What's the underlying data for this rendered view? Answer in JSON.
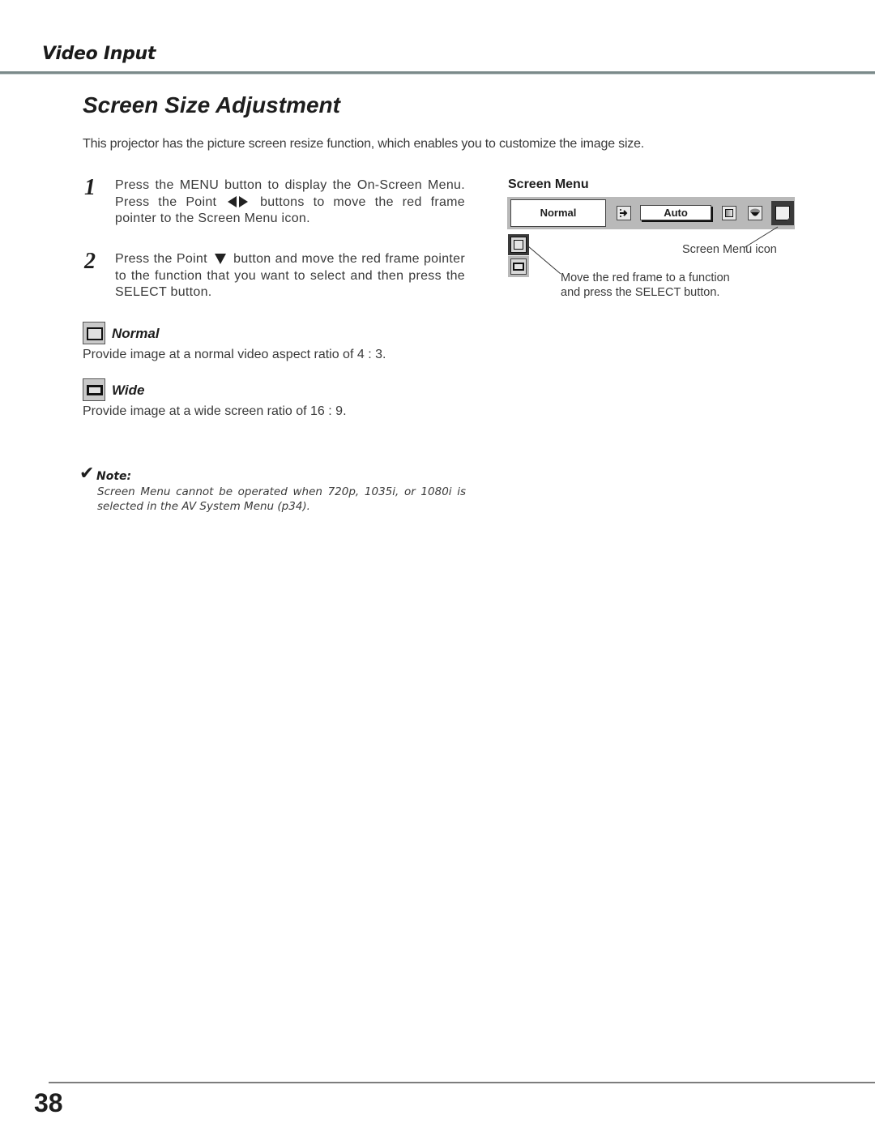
{
  "header": {
    "section": "Video Input"
  },
  "page_title": "Screen Size Adjustment",
  "intro": "This projector has the picture screen resize function, which enables you to customize the  image size.",
  "steps": [
    {
      "number": "1",
      "text_a": "Press the MENU button to display the On-Screen Menu.  Press the Point ",
      "icons": [
        "point-left",
        "point-right"
      ],
      "text_b": " buttons to move the red frame pointer to the Screen Menu icon."
    },
    {
      "number": "2",
      "text_a": "Press the Point ",
      "icons": [
        "point-down"
      ],
      "text_b": " button and move the red frame pointer to the function that you want to select and then press the SELECT button."
    }
  ],
  "options": [
    {
      "label": "Normal",
      "icon": "normal-screen-icon",
      "description": "Provide image at a normal video aspect ratio of 4 : 3."
    },
    {
      "label": "Wide",
      "icon": "wide-screen-icon",
      "description": "Provide image at a wide screen ratio of 16 : 9."
    }
  ],
  "note": {
    "label": "Note:",
    "text": "Screen Menu cannot be operated when 720p, 1035i, or 1080i is selected in the AV System Menu (p34)."
  },
  "screen_menu": {
    "title": "Screen Menu",
    "current_mode": "Normal",
    "auto_label": "Auto",
    "icons": [
      "input-icon",
      "image-adjust-icon",
      "color-icon",
      "screen-menu-icon"
    ],
    "callout_icon": "Screen Menu icon",
    "callout_move_1": "Move the red frame to a function",
    "callout_move_2": "and press the SELECT button."
  },
  "footer": {
    "page_number": "38"
  }
}
